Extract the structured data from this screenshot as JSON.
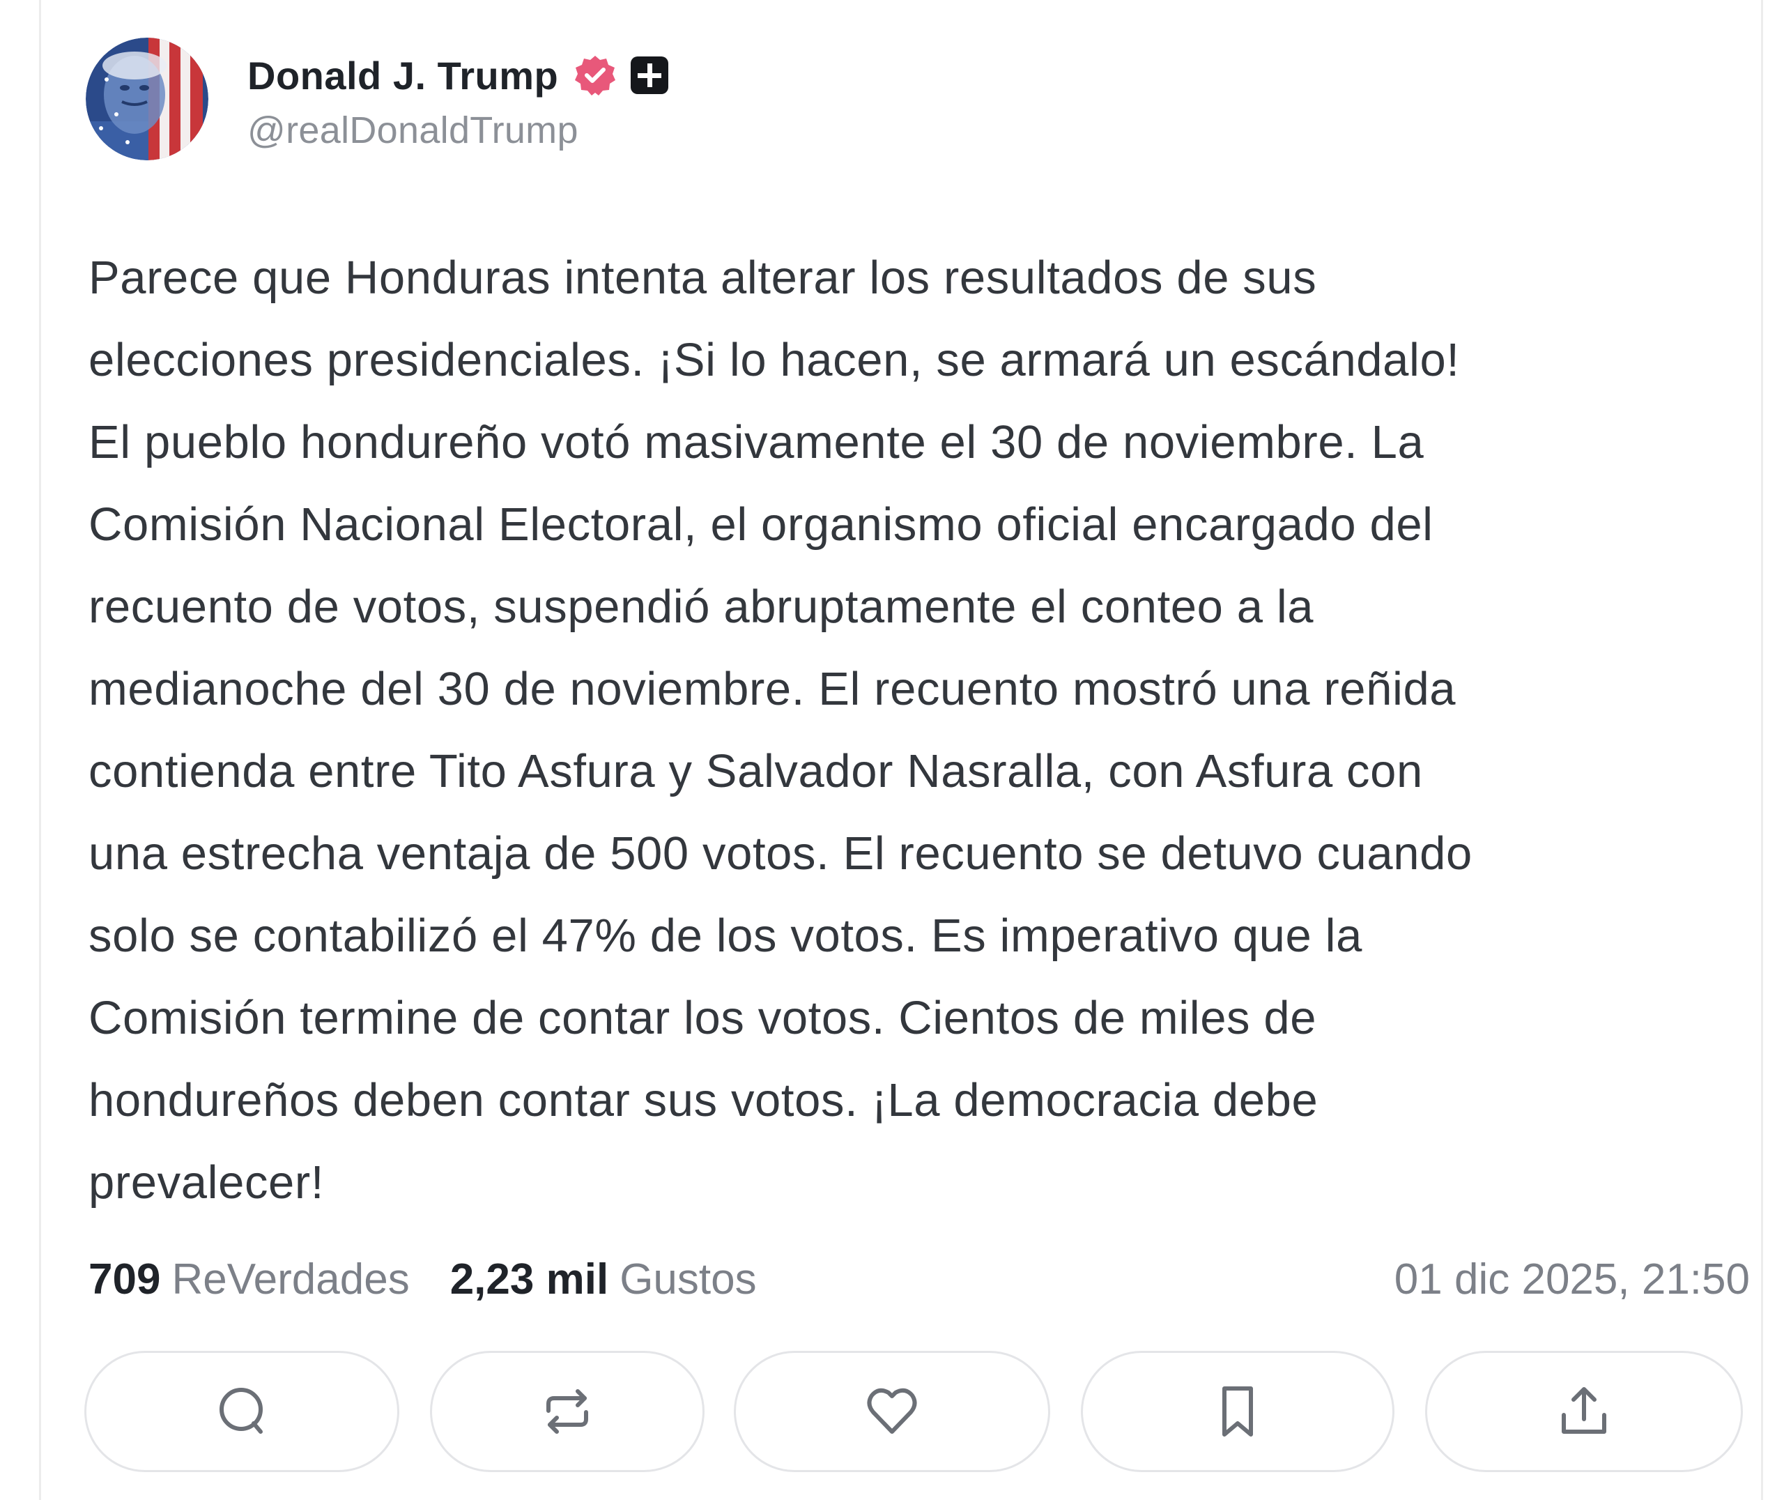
{
  "post": {
    "author": {
      "display_name": "Donald J. Trump",
      "handle": "@realDonaldTrump",
      "verified_icon": "verified-badge-icon",
      "plus_icon": "plus-square-icon"
    },
    "text": "Parece que Honduras intenta alterar los resultados de sus\nelecciones presidenciales. ¡Si lo hacen, se armará un escándalo!\nEl pueblo hondureño votó masivamente el 30 de noviembre. La\nComisión Nacional Electoral, el organismo oficial encargado del\nrecuento de votos, suspendió abruptamente el conteo a la\nmedianoche del 30 de noviembre. El recuento mostró una reñida\ncontienda entre Tito Asfura y Salvador Nasralla, con Asfura con\nuna estrecha ventaja de 500 votos. El recuento se detuvo cuando\nsolo se contabilizó el 47% de los votos. Es imperativo que la\nComisión termine de contar los votos. Cientos de miles de\nhondureños deben contar sus votos. ¡La democracia debe\nprevalecer!",
    "stats": {
      "reposts_count": "709",
      "reposts_label": "ReVerdades",
      "likes_count": "2,23 mil",
      "likes_label": "Gustos"
    },
    "timestamp": "01 dic 2025, 21:50"
  },
  "actions": [
    {
      "name": "reply-button",
      "icon": "comment-icon"
    },
    {
      "name": "repost-button",
      "icon": "repost-icon"
    },
    {
      "name": "like-button",
      "icon": "heart-icon"
    },
    {
      "name": "bookmark-button",
      "icon": "bookmark-icon"
    },
    {
      "name": "share-button",
      "icon": "share-icon"
    }
  ],
  "colors": {
    "verified_badge": "#e8587a",
    "text_primary": "#1f2329",
    "text_secondary": "#7c8088",
    "border": "#e4e5e8"
  }
}
